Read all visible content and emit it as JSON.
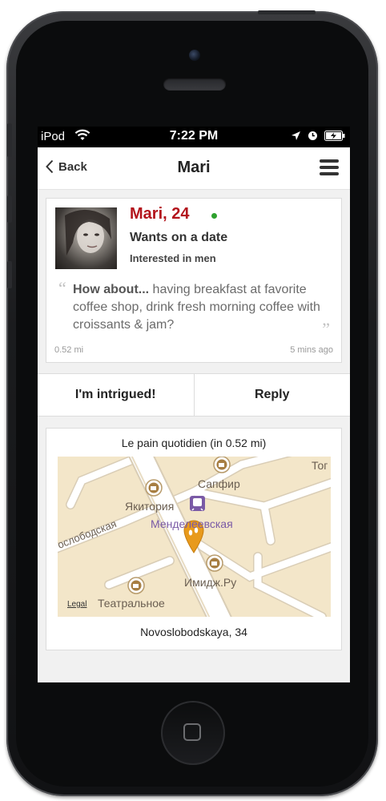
{
  "status_bar": {
    "carrier": "iPod",
    "time": "7:22 PM"
  },
  "nav": {
    "back_label": "Back",
    "title": "Mari"
  },
  "profile": {
    "name_age": "Mari, 24",
    "status": "Wants on a date",
    "interest": "Interested in men",
    "quote_lead": "How about...",
    "quote_text": " having breakfast at favorite coffee shop, drink fresh morning coffee with croissants & jam?",
    "distance": "0.52 mi",
    "time_ago": "5 mins ago"
  },
  "actions": {
    "intrigued_label": "I'm intrigued!",
    "reply_label": "Reply"
  },
  "location": {
    "title": "Le pain quotidien (in 0.52 mi)",
    "address": "Novoslobodskaya, 34",
    "map_labels": {
      "sapfir": "Сапфир",
      "yakitoriya": "Якитория",
      "mendeleevskaya": "Менделеевская",
      "novoslobodskaya": "ослободская",
      "imidzh": "Имидж.Ру",
      "teatralnoe": "Театральное",
      "top": "Тог",
      "legal": "Legal"
    }
  },
  "colors": {
    "accent_red": "#b3141c",
    "online_green": "#2ea12e",
    "pin_orange": "#e89a1c",
    "metro_purple": "#7a5aa6"
  }
}
